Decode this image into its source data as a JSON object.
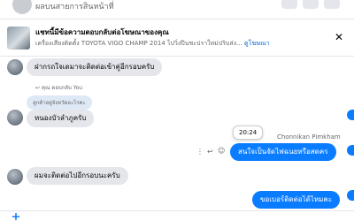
{
  "header": {
    "title": "ผลบนสายการสินหน้าที่"
  },
  "banner": {
    "title": "แชทนี้มีข้อความตอบกลับต่อโฆษณาของคุณ",
    "subtitle": "เครื่องเสียงติดตั้ง TOYOTA VIGO CHAMP 2014 ไปวิ่งปีนชะปราใหม่ปริบส่ง...",
    "link": "ดูโฆษณา"
  },
  "messages": [
    {
      "text": "ฝากรถใจเดมาจะติดต่อเข้าคู่อีกรอบครับ"
    },
    {
      "reply_meta": "คุณ ตอบกลับ You",
      "reply_quote": "ลูกค้าอยู่จังหวัดอะไรคะ",
      "text": "หนองบัวลำภูครับ"
    },
    {
      "time_tooltip": "20:24",
      "sender": "Chonnikan Pimkham",
      "text": "สนใจเป็นจัดไฟฉนยหรือสดคร"
    },
    {
      "text": "ผมจะติดต่อไปอีกรอบนะครับ"
    },
    {
      "text": "ขอเบอร์ติดต่อได้ไหมคะ"
    }
  ]
}
